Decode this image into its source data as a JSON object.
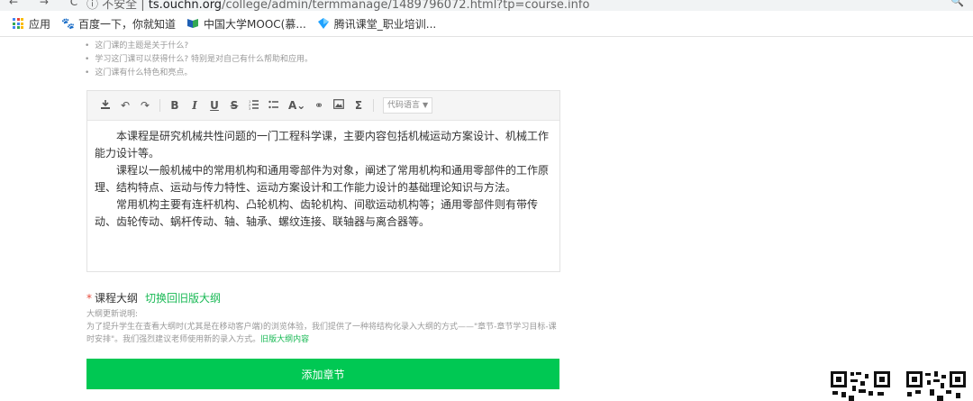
{
  "browser": {
    "url_prefix": "ⓘ 不安全 | ",
    "url_host": "ts.ouchn.org",
    "url_path": "/college/admin/termmanage/1489796072.html?tp=course.info"
  },
  "bookmarks": [
    {
      "icon": "apps-grid-icon",
      "label": "应用"
    },
    {
      "icon": "baidu-paw-icon",
      "label": "百度一下，你就知道"
    },
    {
      "icon": "mooc-icon",
      "label": "中国大学MOOC(慕..."
    },
    {
      "icon": "tencent-classroom-icon",
      "label": "腾讯课堂_职业培训..."
    }
  ],
  "tips": [
    "这门课的主题是关于什么?",
    "学习这门课可以获得什么? 特别是对自己有什么帮助和应用。",
    "这门课有什么特色和亮点。"
  ],
  "toolbar": {
    "code_language": "代码语言"
  },
  "editor": {
    "paragraphs": [
      "本课程是研究机械共性问题的一门工程科学课，主要内容包括机械运动方案设计、机械工作能力设计等。",
      "课程以一般机械中的常用机构和通用零部件为对象，阐述了常用机构和通用零部件的工作原理、结构特点、运动与传力特性、运动方案设计和工作能力设计的基础理论知识与方法。",
      "常用机构主要有连杆机构、凸轮机构、齿轮机构、间歇运动机构等；通用零部件则有带传动、齿轮传动、蜗杆传动、轴、轴承、螺纹连接、联轴器与离合器等。"
    ]
  },
  "syllabus": {
    "required_mark": "*",
    "title": "课程大纲",
    "switch_link": "切换回旧版大纲",
    "note_heading": "大纲更新说明:",
    "note_body": "为了提升学生在查看大纲时(尤其是在移动客户端)的浏览体验，我们提供了一种将结构化录入大纲的方式——\"章节-章节学习目标-课时安排\"。我们强烈建议老师使用新的录入方式。",
    "old_content_link": "旧版大纲内容",
    "add_chapter_button": "添加章节"
  },
  "colors": {
    "accent_green": "#00c853",
    "link_green": "#19b955",
    "required_red": "#e74c3c"
  }
}
